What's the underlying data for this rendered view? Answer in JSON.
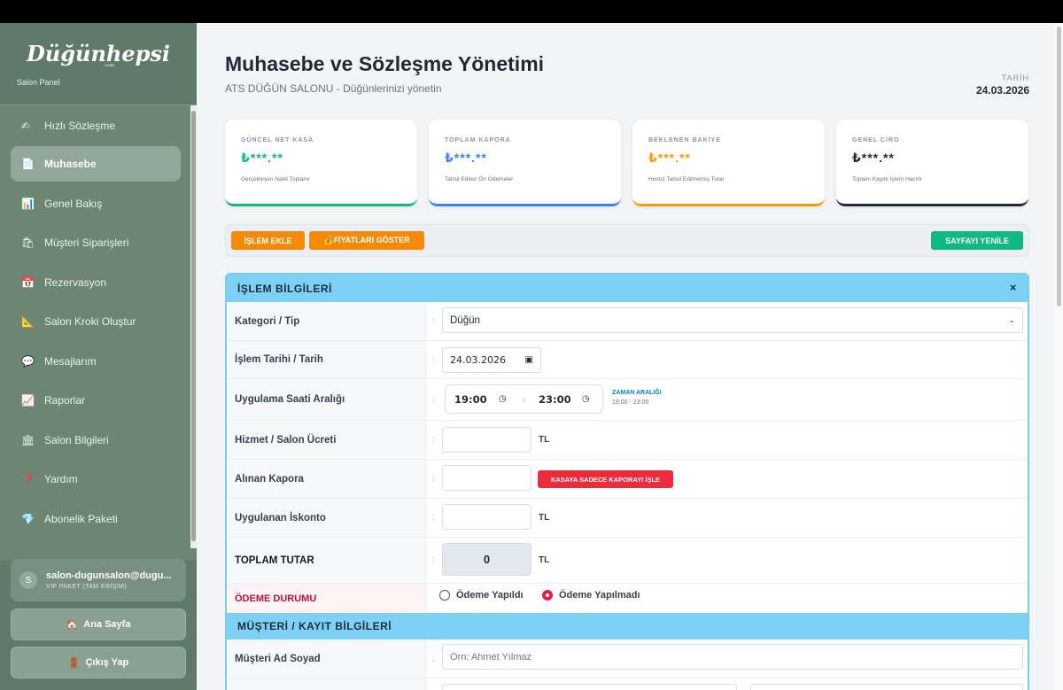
{
  "sidebar": {
    "logo": "Düğünhepsi",
    "logo_sub": ".com",
    "panel_label": "Salon Panel",
    "items": [
      {
        "icon": "✍",
        "label": "Hızlı Sözleşme"
      },
      {
        "icon": "📄",
        "label": "Muhasebe",
        "active": true
      },
      {
        "icon": "📊",
        "label": "Genel Bakış"
      },
      {
        "icon": "🛍",
        "label": "Müşteri Siparişleri"
      },
      {
        "icon": "📅",
        "label": "Rezervasyon"
      },
      {
        "icon": "📐",
        "label": "Salon Kroki Oluştur"
      },
      {
        "icon": "💬",
        "label": "Mesajlarım"
      },
      {
        "icon": "📈",
        "label": "Raporlar"
      },
      {
        "icon": "🏛",
        "label": "Salon Bilgileri"
      },
      {
        "icon": "❓",
        "label": "Yardım"
      },
      {
        "icon": "💎",
        "label": "Abonelik Paketi"
      }
    ],
    "user": {
      "avatar": "S",
      "email": "salon-dugunsalon@dugu...",
      "plan": "VIP PAKET (TAM ERİŞİM)"
    },
    "home_button": {
      "icon": "🏠",
      "label": "Ana Sayfa"
    },
    "logout_button": {
      "icon": "🚪",
      "label": "Çıkış Yap"
    }
  },
  "header": {
    "title": "Muhasebe ve Sözleşme Yönetimi",
    "subtitle": "ATS DÜĞÜN SALONU - Düğünlerinizi yönetin",
    "date_label": "TARİH",
    "date_value": "24.03.2026"
  },
  "cards": [
    {
      "label": "GÜNCEL NET KASA",
      "value": "₺***.**",
      "desc": "Gerçekleşen Nakit Toplamı",
      "color": "#10b981"
    },
    {
      "label": "TOPLAM KAPORA",
      "value": "₺***.**",
      "desc": "Tahsil Edilen Ön Ödemeler",
      "color": "#3b82f6"
    },
    {
      "label": "BEKLENEN BAKİYE",
      "value": "₺***.**",
      "desc": "Henüz Tahsil Edilmemiş Tutar",
      "color": "#f59e0b"
    },
    {
      "label": "GENEL CİRO",
      "value": "₺***.**",
      "desc": "Toplam Kayıtlı İşlem Hacmi",
      "color": "#1f2937"
    }
  ],
  "toolbar": {
    "add_label": "İŞLEM EKLE",
    "prices_label": "💰FİYATLARI GÖSTER",
    "refresh_label": "SAYFAYI YENİLE"
  },
  "form": {
    "section_title": "İŞLEM BİLGİLERİ",
    "close": "×",
    "category_label": "Kategori / Tip",
    "category_value": "Düğün",
    "date_label": "İşlem Tarihi / Tarih",
    "date_value": "24.03.2026",
    "time_label": "Uygulama Saati Aralığı",
    "time_start": "19:00",
    "time_end": "23:00",
    "range_title": "ZAMAN ARALIĞI",
    "range_value": "19:00 - 23:00",
    "fee_label": "Hizmet / Salon Ücreti",
    "fee_unit": "TL",
    "deposit_label": "Alınan Kapora",
    "deposit_button": "KASAYA SADECE KAPORAYI İŞLE",
    "discount_label": "Uygulanan İskonto",
    "discount_unit": "TL",
    "total_label": "TOPLAM TUTAR",
    "total_value": "0",
    "total_unit": "TL",
    "payment_label": "ÖDEME DURUMU",
    "paid_label": "Ödeme Yapıldı",
    "unpaid_label": "Ödeme Yapılmadı",
    "customer_section_title": "MÜŞTERİ / KAYIT BİLGİLERİ",
    "customer_name_label": "Müşteri Ad Soyad",
    "customer_name_placeholder": "Örn: Ahmet Yılmaz"
  }
}
